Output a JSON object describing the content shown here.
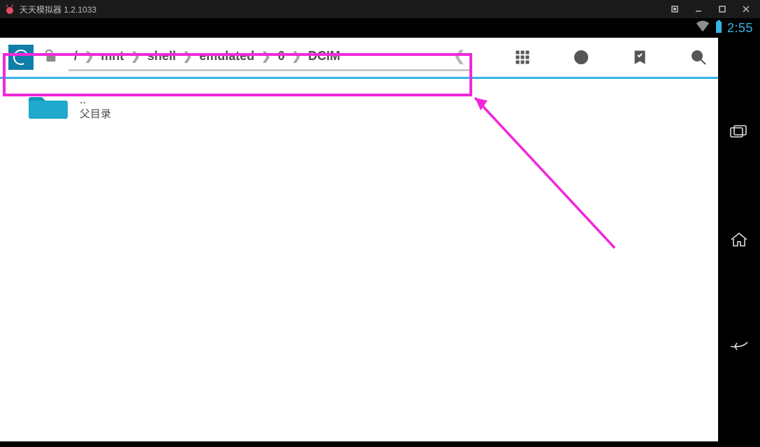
{
  "emulator": {
    "title": "天天模拟器 1.2.1033"
  },
  "statusbar": {
    "clock": "2:55"
  },
  "breadcrumbs": {
    "root": "/",
    "items": [
      "mnt",
      "shell",
      "emulated",
      "0",
      "DCIM"
    ]
  },
  "files": {
    "parent": {
      "name": "..",
      "label": "父目录"
    }
  }
}
